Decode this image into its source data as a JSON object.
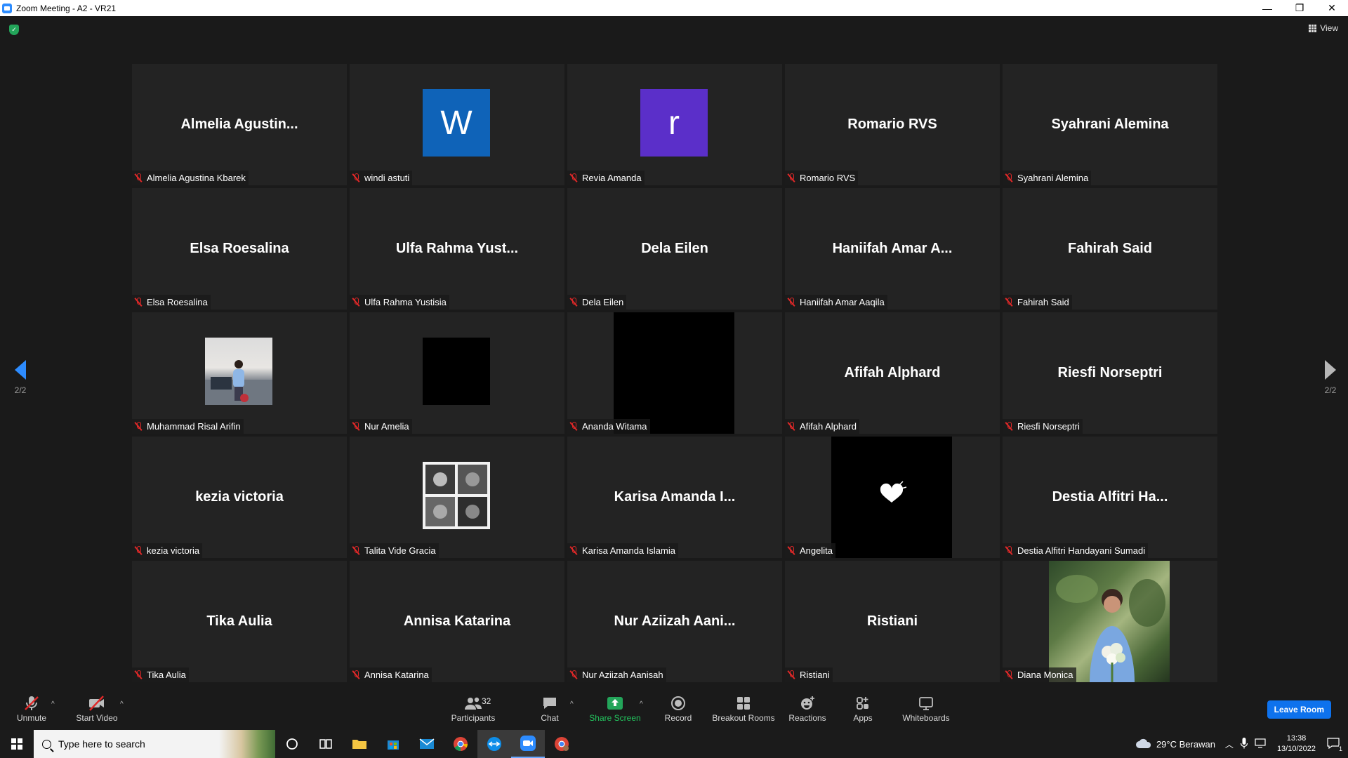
{
  "window": {
    "title": "Zoom Meeting - A2 - VR21",
    "minimize": "—",
    "restore": "❐",
    "close": "✕"
  },
  "view_label": "View",
  "pagination": {
    "left_label": "2/2",
    "right_label": "2/2"
  },
  "tiles": [
    {
      "big": "Almelia  Agustin...",
      "name": "Almelia Agustina Kbarek"
    },
    {
      "avatar": "W",
      "avatar_color": "#0f63b8",
      "name": "windi astuti"
    },
    {
      "avatar": "r",
      "avatar_color": "#5b2fc9",
      "name": "Revia Amanda"
    },
    {
      "big": "Romario RVS",
      "name": "Romario RVS"
    },
    {
      "big": "Syahrani Alemina",
      "name": "Syahrani Alemina"
    },
    {
      "big": "Elsa Roesalina",
      "name": "Elsa Roesalina"
    },
    {
      "big": "Ulfa Rahma Yust...",
      "name": "Ulfa Rahma Yustisia"
    },
    {
      "big": "Dela Eilen",
      "name": "Dela Eilen"
    },
    {
      "big": "Haniifah Amar A...",
      "name": "Haniifah Amar Aaqila"
    },
    {
      "big": "Fahirah Said",
      "name": "Fahirah Said"
    },
    {
      "photo": "room",
      "name": "Muhammad Risal Arifin"
    },
    {
      "photo": "black-small",
      "name": "Nur Amelia"
    },
    {
      "photo": "black-large",
      "name": "Ananda Witama"
    },
    {
      "big": "Afifah Alphard",
      "name": "Afifah Alphard"
    },
    {
      "big": "Riesfi Norseptri",
      "name": "Riesfi Norseptri"
    },
    {
      "big": "kezia victoria",
      "name": "kezia victoria"
    },
    {
      "photo": "collage",
      "name": "Talita Vide Gracia"
    },
    {
      "big": "Karisa Amanda I...",
      "name": "Karisa Amanda Islamia"
    },
    {
      "photo": "black-heart",
      "name": "Angelita"
    },
    {
      "big": "Destia Alfitri Ha...",
      "name": "Destia Alfitri Handayani Sumadi"
    },
    {
      "big": "Tika Aulia",
      "name": "Tika Aulia"
    },
    {
      "big": "Annisa Katarina",
      "name": "Annisa Katarina"
    },
    {
      "big": "Nur Aziizah Aani...",
      "name": "Nur Aziizah Aanisah"
    },
    {
      "big": "Ristiani",
      "name": "Ristiani"
    },
    {
      "photo": "video-person",
      "name": "Diana Monica"
    }
  ],
  "toolbar": {
    "unmute": "Unmute",
    "start_video": "Start Video",
    "participants": "Participants",
    "participants_count": "32",
    "chat": "Chat",
    "share_screen": "Share Screen",
    "record": "Record",
    "breakout_rooms": "Breakout Rooms",
    "reactions": "Reactions",
    "apps": "Apps",
    "whiteboards": "Whiteboards",
    "leave_room": "Leave Room"
  },
  "taskbar": {
    "search_placeholder": "Type here to search",
    "weather": "29°C  Berawan",
    "time": "13:38",
    "date": "13/10/2022",
    "notification_count": "1"
  },
  "colors": {
    "accent": "#0e72ed",
    "share_green": "#23a55a",
    "mute_red": "#e02828"
  }
}
